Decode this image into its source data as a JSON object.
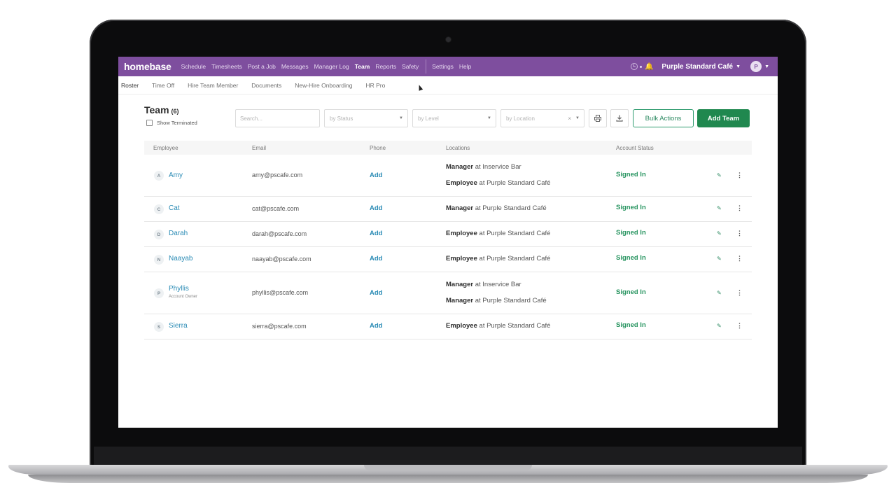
{
  "nav": {
    "logo": "homebase",
    "links": [
      "Schedule",
      "Timesheets",
      "Post a Job",
      "Messages",
      "Manager Log",
      "Team",
      "Reports",
      "Safety"
    ],
    "right_links": [
      "Settings",
      "Help"
    ],
    "active": "Team",
    "company": "Purple Standard Café",
    "avatar_initial": "P",
    "clock_icon": "clock-icon",
    "bell_icon": "bell-icon"
  },
  "subnav": {
    "items": [
      "Roster",
      "Time Off",
      "Hire Team Member",
      "Documents",
      "New-Hire Onboarding",
      "HR Pro"
    ],
    "active": "Roster"
  },
  "page": {
    "title": "Team",
    "count": "(6)",
    "show_terminated": "Show Terminated"
  },
  "filters": {
    "search_placeholder": "Search...",
    "status_placeholder": "by Status",
    "level_placeholder": "by Level",
    "location_placeholder": "by Location",
    "clear_symbol": "×"
  },
  "actions": {
    "print_icon": "print-icon",
    "download_icon": "download-icon",
    "bulk_label": "Bulk Actions",
    "add_label": "Add Team"
  },
  "table": {
    "headers": [
      "Employee",
      "Email",
      "Phone",
      "Locations",
      "Account Status"
    ],
    "rows": [
      {
        "initial": "A",
        "name": "Amy",
        "sub": "",
        "email": "amy@pscafe.com",
        "phone": "Add",
        "locations": [
          {
            "role": "Manager",
            "at": " at Inservice Bar"
          },
          {
            "role": "Employee",
            "at": " at Purple Standard Café"
          }
        ],
        "status": "Signed In"
      },
      {
        "initial": "C",
        "name": "Cat",
        "sub": "",
        "email": "cat@pscafe.com",
        "phone": "Add",
        "locations": [
          {
            "role": "Manager",
            "at": " at Purple Standard Café"
          }
        ],
        "status": "Signed In"
      },
      {
        "initial": "D",
        "name": "Darah",
        "sub": "",
        "email": "darah@pscafe.com",
        "phone": "Add",
        "locations": [
          {
            "role": "Employee",
            "at": " at Purple Standard Café"
          }
        ],
        "status": "Signed In"
      },
      {
        "initial": "N",
        "name": "Naayab",
        "sub": "",
        "email": "naayab@pscafe.com",
        "phone": "Add",
        "locations": [
          {
            "role": "Employee",
            "at": " at Purple Standard Café"
          }
        ],
        "status": "Signed In"
      },
      {
        "initial": "P",
        "name": "Phyllis",
        "sub": "Account Owner",
        "email": "phyllis@pscafe.com",
        "phone": "Add",
        "locations": [
          {
            "role": "Manager",
            "at": " at Inservice Bar"
          },
          {
            "role": "Manager",
            "at": " at Purple Standard Café"
          }
        ],
        "status": "Signed In"
      },
      {
        "initial": "S",
        "name": "Sierra",
        "sub": "",
        "email": "sierra@pscafe.com",
        "phone": "Add",
        "locations": [
          {
            "role": "Employee",
            "at": " at Purple Standard Café"
          }
        ],
        "status": "Signed In"
      }
    ]
  },
  "colors": {
    "brand_purple": "#7e4e9e",
    "link_blue": "#2a8bb5",
    "status_green": "#25935e",
    "add_button_green": "#20884f"
  }
}
